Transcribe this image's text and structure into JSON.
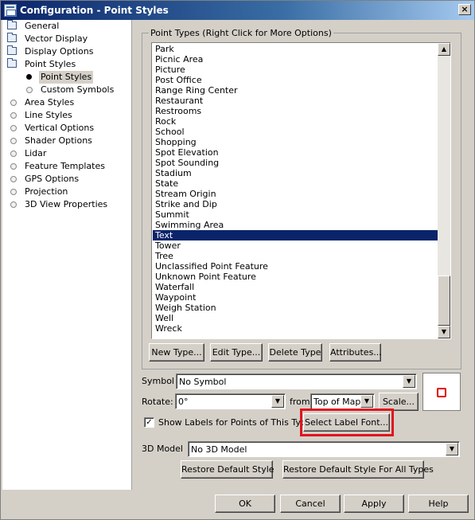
{
  "window": {
    "title": "Configuration - Point Styles",
    "close_glyph": "×"
  },
  "tree": {
    "items": [
      {
        "label": "General",
        "icon": "folder-icon"
      },
      {
        "label": "Vector Display",
        "icon": "folder-icon"
      },
      {
        "label": "Display Options",
        "icon": "folder-icon"
      },
      {
        "label": "Point Styles",
        "icon": "folder-open-icon"
      },
      {
        "label": "Point Styles",
        "icon": "bullet-icon",
        "selected": true
      },
      {
        "label": "Custom Symbols",
        "icon": "dot-icon"
      },
      {
        "label": "Area Styles",
        "icon": "dot-icon"
      },
      {
        "label": "Line Styles",
        "icon": "dot-icon"
      },
      {
        "label": "Vertical Options",
        "icon": "dot-icon"
      },
      {
        "label": "Shader Options",
        "icon": "dot-icon"
      },
      {
        "label": "Lidar",
        "icon": "dot-icon"
      },
      {
        "label": "Feature Templates",
        "icon": "dot-icon"
      },
      {
        "label": "GPS Options",
        "icon": "dot-icon"
      },
      {
        "label": "Projection",
        "icon": "dot-icon"
      },
      {
        "label": "3D View Properties",
        "icon": "dot-icon"
      }
    ]
  },
  "point_types": {
    "group_title": "Point Types (Right Click for More Options)",
    "items": [
      "Park",
      "Picnic Area",
      "Picture",
      "Post Office",
      "Range Ring Center",
      "Restaurant",
      "Restrooms",
      "Rock",
      "School",
      "Shopping",
      "Spot Elevation",
      "Spot Sounding",
      "Stadium",
      "State",
      "Stream Origin",
      "Strike and Dip",
      "Summit",
      "Swimming Area",
      "Text",
      "Tower",
      "Tree",
      "Unclassified Point Feature",
      "Unknown Point Feature",
      "Waterfall",
      "Waypoint",
      "Weigh Station",
      "Well",
      "Wreck"
    ],
    "selected": "Text",
    "buttons": {
      "new_type": "New Type...",
      "edit_type": "Edit Type...",
      "delete_type": "Delete Type",
      "attributes": "Attributes..."
    }
  },
  "symbol": {
    "label": "Symbol",
    "value": "No Symbol"
  },
  "rotate": {
    "label": "Rotate:",
    "value": "0°",
    "from_label": "from",
    "from_value": "Top of Map",
    "scale_button": "Scale..."
  },
  "labels": {
    "checkbox_label": "Show Labels for Points of This Type",
    "checked": true,
    "check_glyph": "✓",
    "font_button": "Select Label  Font..."
  },
  "model3d": {
    "label": "3D Model",
    "value": "No 3D Model"
  },
  "restore": {
    "default_style": "Restore Default Style",
    "all_types": "Restore Default Style For All Types"
  },
  "dialog_buttons": {
    "ok": "OK",
    "cancel": "Cancel",
    "apply": "Apply",
    "help": "Help"
  },
  "glyphs": {
    "up": "▲",
    "down": "▼"
  },
  "colors": {
    "title_start": "#0a246a",
    "selection": "#0a246a",
    "highlight": "#e0141e",
    "symbol": "#e00000"
  }
}
